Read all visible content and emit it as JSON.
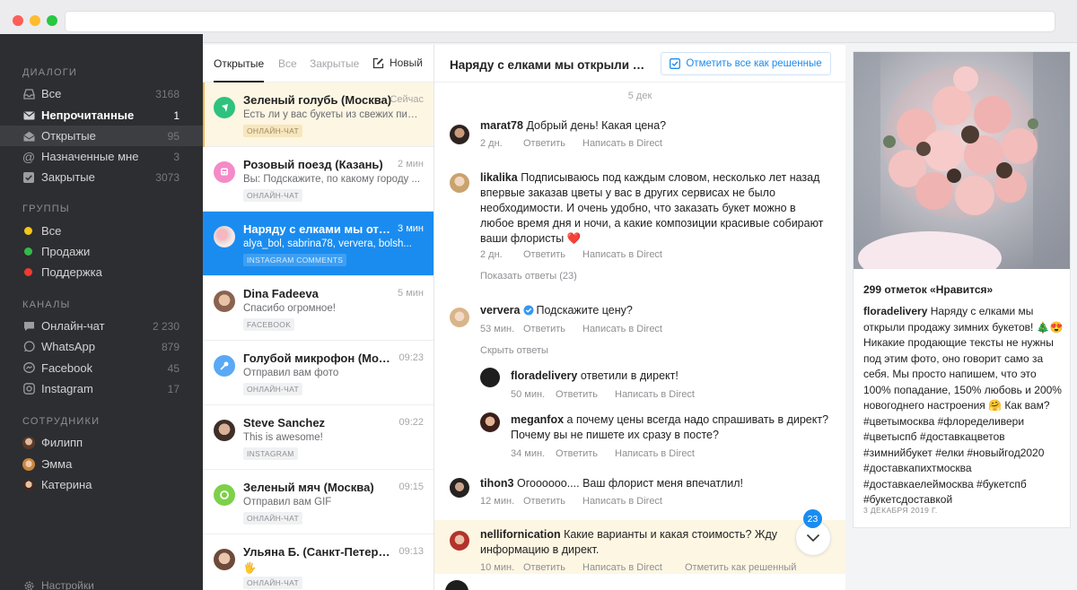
{
  "sidebar": {
    "sections": {
      "dialogs": "ДИАЛОГИ",
      "groups": "ГРУППЫ",
      "channels": "КАНАЛЫ",
      "staff": "СОТРУДНИКИ"
    },
    "dialogs": [
      {
        "label": "Все",
        "count": "3168",
        "icon": "inbox-icon"
      },
      {
        "label": "Непрочитанные",
        "count": "1",
        "icon": "mail-icon"
      },
      {
        "label": "Открытые",
        "count": "95",
        "icon": "open-envelope-icon"
      },
      {
        "label": "Назначенные мне",
        "count": "3",
        "icon": "at-icon"
      },
      {
        "label": "Закрытые",
        "count": "3073",
        "icon": "checkbox-icon"
      }
    ],
    "groups": [
      {
        "label": "Все",
        "color": "#f5c518"
      },
      {
        "label": "Продажи",
        "color": "#35b94a"
      },
      {
        "label": "Поддержка",
        "color": "#ef3b30"
      }
    ],
    "channels": [
      {
        "label": "Онлайн-чат",
        "count": "2 230",
        "icon": "chat-bubble-icon"
      },
      {
        "label": "WhatsApp",
        "count": "879",
        "icon": "whatsapp-icon"
      },
      {
        "label": "Facebook",
        "count": "45",
        "icon": "messenger-icon"
      },
      {
        "label": "Instagram",
        "count": "17",
        "icon": "instagram-icon"
      }
    ],
    "staff": [
      {
        "label": "Филипп"
      },
      {
        "label": "Эмма"
      },
      {
        "label": "Катерина"
      }
    ],
    "settings": "Настройки"
  },
  "convlist": {
    "tabs": [
      "Открытые",
      "Все",
      "Закрытые"
    ],
    "new_label": "Новый",
    "items": [
      {
        "title": "Зеленый голубь (Москва)",
        "time": "Сейчас",
        "preview": "Есть ли у вас букеты из свежих пион...",
        "tag": "ОНЛАЙН-ЧАТ",
        "avatar_color": "#2ec27e"
      },
      {
        "title": "Розовый поезд (Казань)",
        "time": "2 мин",
        "preview": "Вы: Подскажите, по какому городу ...",
        "tag": "ОНЛАЙН-ЧАТ",
        "avatar_color": "#f58ac8"
      },
      {
        "title": "Наряду с елками мы откры...",
        "time": "3 мин",
        "preview": "alya_bol, sabrina78, ververa, bolsh...",
        "tag": "INSTAGRAM COMMENTS",
        "avatar_color": "#f1d7d9"
      },
      {
        "title": "Dina Fadeeva",
        "time": "5 мин",
        "preview": "Спасибо огромное!",
        "tag": "FACEBOOK",
        "avatar_color": "#c9a58c"
      },
      {
        "title": "Голубой микрофон (Москва)",
        "time": "09:23",
        "preview": "Отправил вам фото",
        "tag": "ОНЛАЙН-ЧАТ",
        "avatar_color": "#5aa9f5"
      },
      {
        "title": "Steve Sanchez",
        "time": "09:22",
        "preview": "This is awesome!",
        "tag": "INSTAGRAM",
        "avatar_color": "#8a6f5e"
      },
      {
        "title": "Зеленый мяч (Москва)",
        "time": "09:15",
        "preview": "Отправил вам GIF",
        "tag": "ОНЛАЙН-ЧАТ",
        "avatar_color": "#7ed04a"
      },
      {
        "title": "Ульяна Б. (Санкт-Петербург)",
        "time": "09:13",
        "preview": "🖐",
        "tag": "ОНЛАЙН-ЧАТ",
        "avatar_color": "#b98f7a"
      }
    ]
  },
  "chat": {
    "title": "Наряду с елками мы открыли пр...",
    "resolve_all": "Отметить все как решенные",
    "date": "5 дек",
    "reply": "Ответить",
    "direct": "Написать в Direct",
    "mark_resolved": "Отметить как решенный",
    "unread_count": "23",
    "messages": [
      {
        "user": "marat78",
        "text": "Добрый день! Какая цена?",
        "time": "2 дн."
      },
      {
        "user": "likalika",
        "text": "Подписываюсь под каждым словом, несколько лет назад впервые заказав цветы у вас в других сервисах не было необходимости. И очень удобно, что заказать букет можно в любое время дня и ночи, а какие композиции красивые собирают ваши флористы ❤️",
        "time": "2 дн.",
        "replies": "Показать ответы (23)"
      },
      {
        "user": "ververa",
        "text": "Подскажите цену?",
        "time": "53 мин.",
        "replies": "Скрыть ответы"
      },
      {
        "user": "floradelivery",
        "text": "ответили в директ!",
        "time": "50 мин."
      },
      {
        "user": "meganfox",
        "text": "а почему цены всегда надо спрашивать в директ? Почему вы не пишете их сразу в посте?",
        "time": "34 мин."
      },
      {
        "user": "tihon3",
        "text": "Огоооооо.... Ваш флорист меня впечатлил!",
        "time": "12 мин."
      },
      {
        "user": "nellifornication",
        "text": "Какие варианты и какая стоимость? Жду информацию в директ.",
        "time": "10 мин."
      }
    ]
  },
  "post": {
    "likes": "299 отметок «Нравится»",
    "author": "floradelivery",
    "caption": "Наряду с елками мы открыли продажу зимних букетов! 🎄😍 Никакие продающие тексты не нужны под этим фото, оно говорит само за себя. Мы просто напишем, что это 100% попадание, 150% любовь и 200% новогоднего настроения 🤗 Как вам?#цветымосква #флоределивери #цветыспб #доставкацветов #зимнийбукет #елки #новыйгод2020 #доставкапихтмосква #доставкаелеймосква #букетспб #букетсдоставкой",
    "date": "3 ДЕКАБРЯ 2019 Г."
  }
}
